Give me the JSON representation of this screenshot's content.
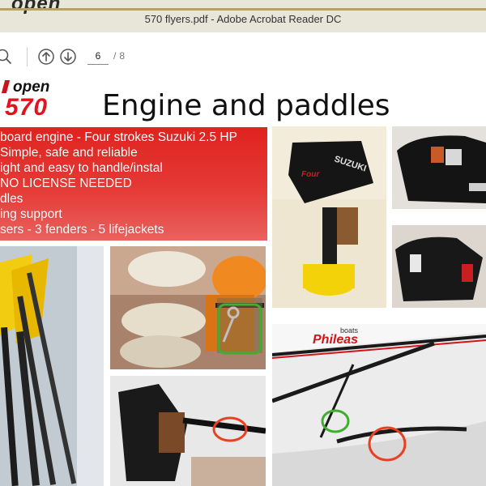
{
  "window": {
    "background_logo_text": "open",
    "title": "570 flyers.pdf - Adobe Acrobat Reader DC"
  },
  "toolbar": {
    "icons": [
      "search-icon",
      "previous-page-icon",
      "next-page-icon"
    ],
    "current_page": "6",
    "page_separator": "/",
    "total_pages": "8"
  },
  "slide": {
    "logo_open": "open",
    "logo_number": "570",
    "title": "Engine and paddles",
    "bullets": [
      "board engine - Four strokes Suzuki 2.5 HP",
      "Simple, safe and reliable",
      "ight and easy to handle/instal",
      "NO LICENSE NEEDED",
      "dles",
      "ing support",
      "sers - 3 fenders - 5 lifejackets"
    ],
    "photo_texts": {
      "engine_brand": "SUZUKI",
      "engine_model": "Four",
      "hull_brand": "Phileas",
      "hull_brand_sub": "boats"
    },
    "colors": {
      "brand_red": "#e0141e",
      "bullet_panel": "#e0231f",
      "highlight_green": "#3fae2e",
      "highlight_red": "#e84020"
    }
  }
}
